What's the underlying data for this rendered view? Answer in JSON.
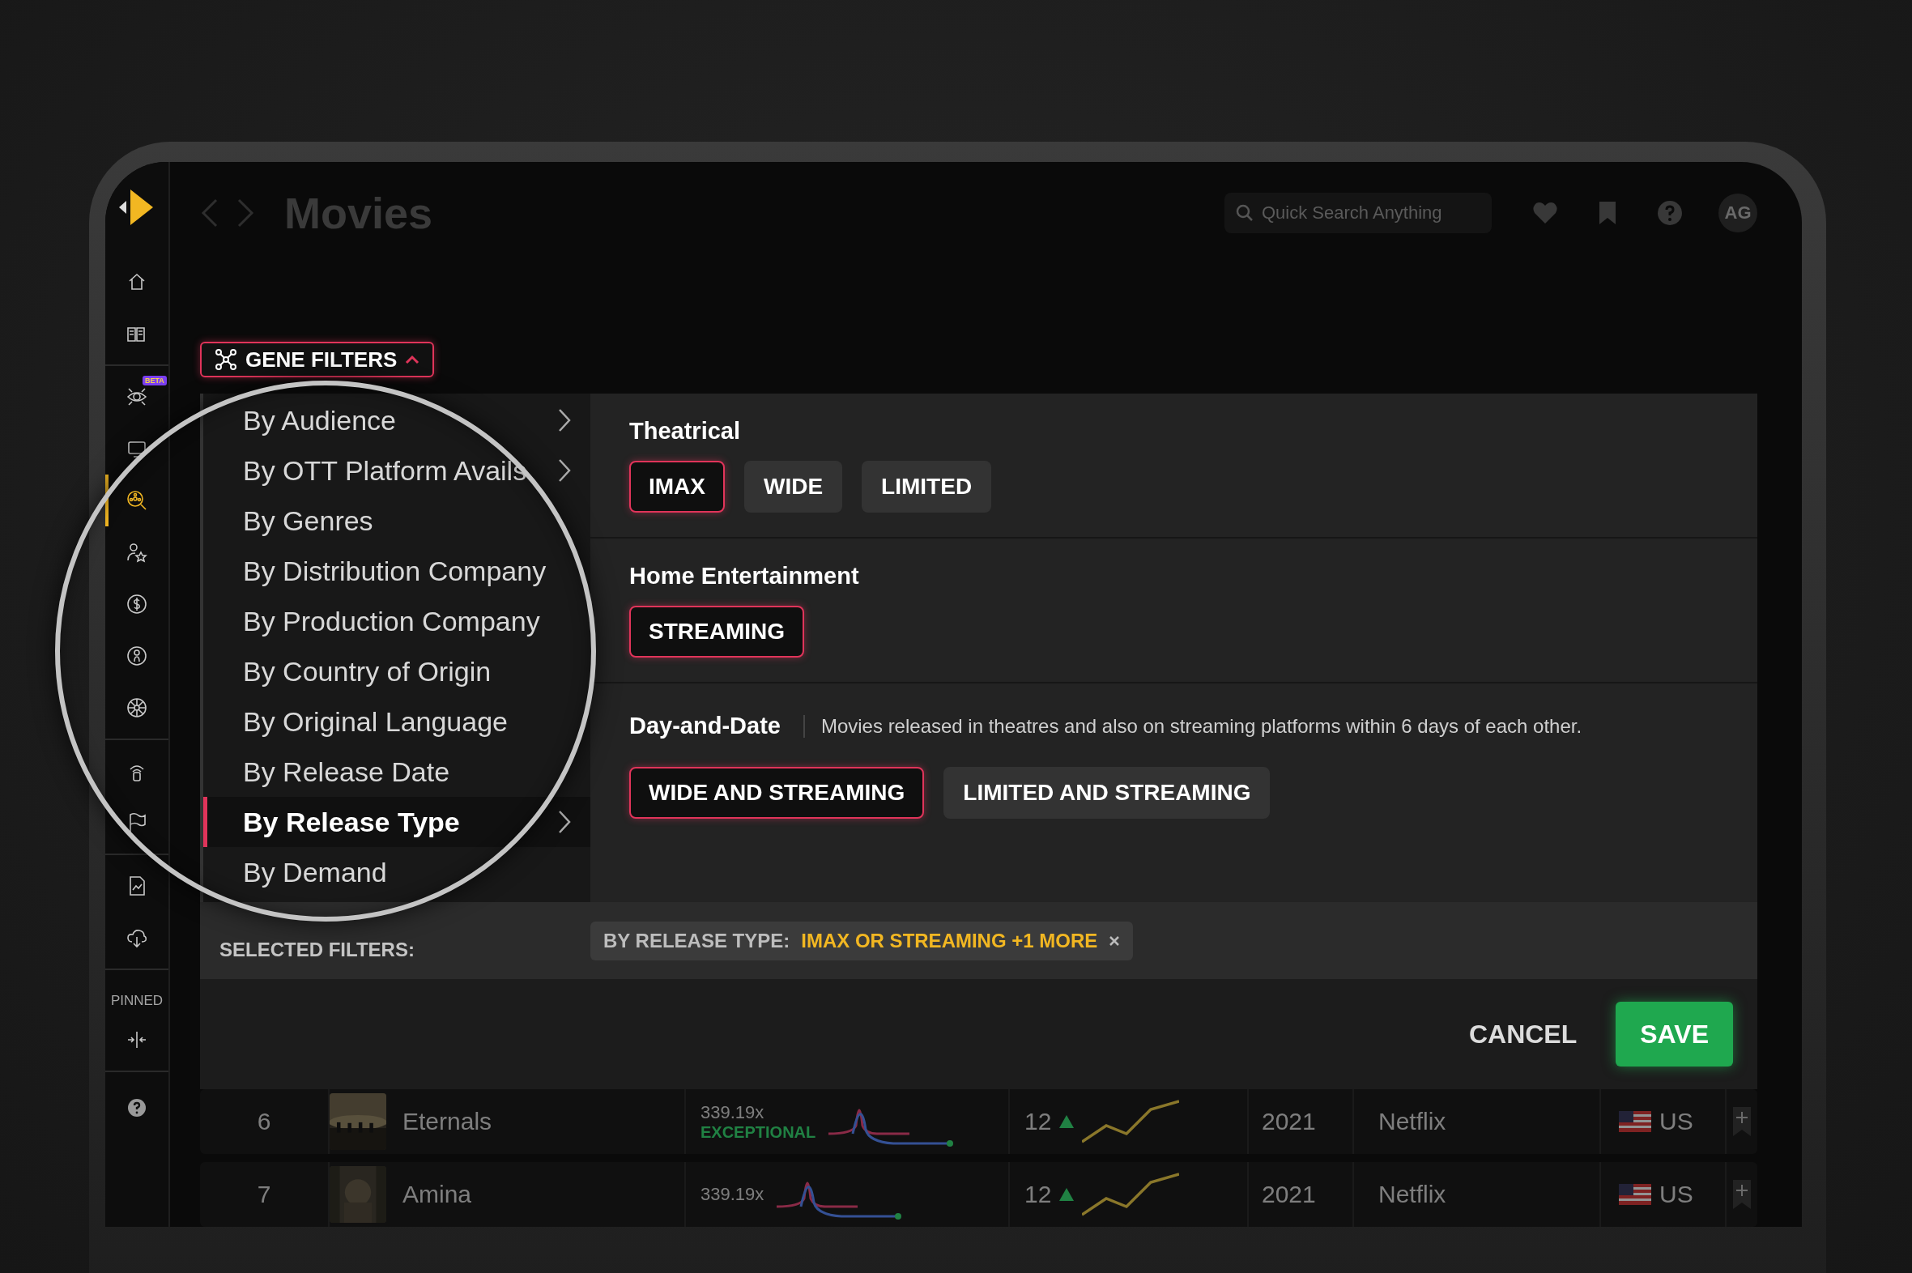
{
  "app": {
    "title": "Movies",
    "search": {
      "placeholder": "Quick Search Anything"
    },
    "avatar": "AG"
  },
  "sidebar": {
    "groups": [
      {
        "items": [
          {
            "selected": false
          },
          {
            "selected": false
          }
        ]
      },
      {
        "items": [
          {
            "selected": false,
            "badge": "BETA"
          },
          {
            "selected": false
          },
          {
            "selected": true
          },
          {
            "selected": false
          },
          {
            "selected": false
          },
          {
            "selected": false
          },
          {
            "selected": false
          }
        ]
      },
      {
        "items": [
          {
            "selected": false
          },
          {
            "selected": false
          }
        ]
      },
      {
        "items": [
          {
            "selected": false
          },
          {
            "selected": false
          }
        ]
      },
      {
        "label": "PINNED",
        "items": [
          {
            "selected": false
          }
        ]
      },
      {
        "items": [
          {
            "selected": false
          }
        ]
      }
    ]
  },
  "gene_filters": {
    "label": "GENE FILTERS",
    "expanded": true
  },
  "filter_menu": [
    {
      "label": "By Audience",
      "selected": false,
      "submenu": true
    },
    {
      "label": "By OTT Platform Avails",
      "selected": false,
      "submenu": true
    },
    {
      "label": "By Genres",
      "selected": false,
      "submenu": false
    },
    {
      "label": "By Distribution Company",
      "selected": false,
      "submenu": false
    },
    {
      "label": "By Production Company",
      "selected": false,
      "submenu": false
    },
    {
      "label": "By Country of Origin",
      "selected": false,
      "submenu": false
    },
    {
      "label": "By Original Language",
      "selected": false,
      "submenu": false
    },
    {
      "label": "By Release Date",
      "selected": false,
      "submenu": false
    },
    {
      "label": "By Release Type",
      "selected": true,
      "submenu": true
    },
    {
      "label": "By Demand",
      "selected": false,
      "submenu": false
    }
  ],
  "sections": [
    {
      "title": "Theatrical",
      "options": [
        {
          "label": "IMAX",
          "selected": true
        },
        {
          "label": "WIDE",
          "selected": false
        },
        {
          "label": "LIMITED",
          "selected": false
        }
      ]
    },
    {
      "title": "Home Entertainment",
      "options": [
        {
          "label": "STREAMING",
          "selected": true
        }
      ]
    },
    {
      "title": "Day-and-Date",
      "description": "Movies released in theatres and also on streaming platforms within 6 days of each other.",
      "options": [
        {
          "label": "WIDE AND STREAMING",
          "selected": true
        },
        {
          "label": "LIMITED AND STREAMING",
          "selected": false
        }
      ]
    }
  ],
  "selected_filters": {
    "label": "SELECTED FILTERS:",
    "chips": [
      {
        "category": "BY RELEASE TYPE:",
        "value": "IMAX OR STREAMING +1 MORE"
      }
    ]
  },
  "buttons": [
    {
      "label": "CANCEL",
      "kind": "text"
    },
    {
      "label": "SAVE",
      "kind": "primary"
    }
  ],
  "table": {
    "rows": [
      {
        "rank": "6",
        "title": "Eternals",
        "multiple": "339.19x",
        "rating": "EXCEPTIONAL",
        "count": "12",
        "year": "2021",
        "platform": "Netflix",
        "country": "US"
      },
      {
        "rank": "7",
        "title": "Amina",
        "multiple": "339.19x",
        "count": "12",
        "year": "2021",
        "platform": "Netflix",
        "country": "US"
      }
    ]
  }
}
